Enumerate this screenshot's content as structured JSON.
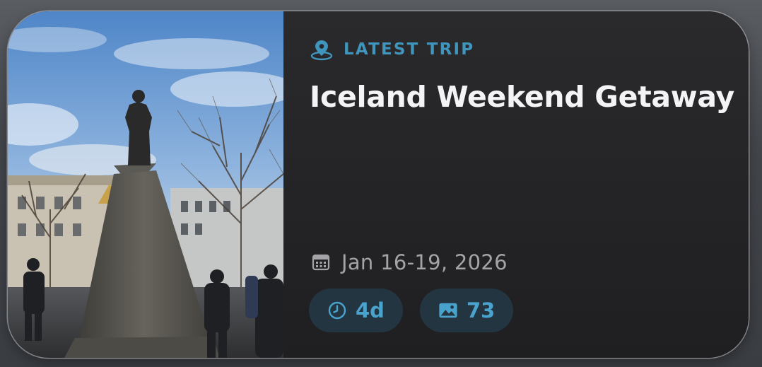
{
  "trip_card": {
    "eyebrow_icon": "location-pin-icon",
    "eyebrow_label": "LATEST TRIP",
    "title": "Iceland Weekend Getaway",
    "date_icon": "calendar-icon",
    "date_range": "Jan 16-19, 2026",
    "duration": {
      "icon": "clock-icon",
      "value": "4d"
    },
    "photos": {
      "icon": "photo-icon",
      "value": "73"
    },
    "accent_color": "#3f95bb"
  }
}
